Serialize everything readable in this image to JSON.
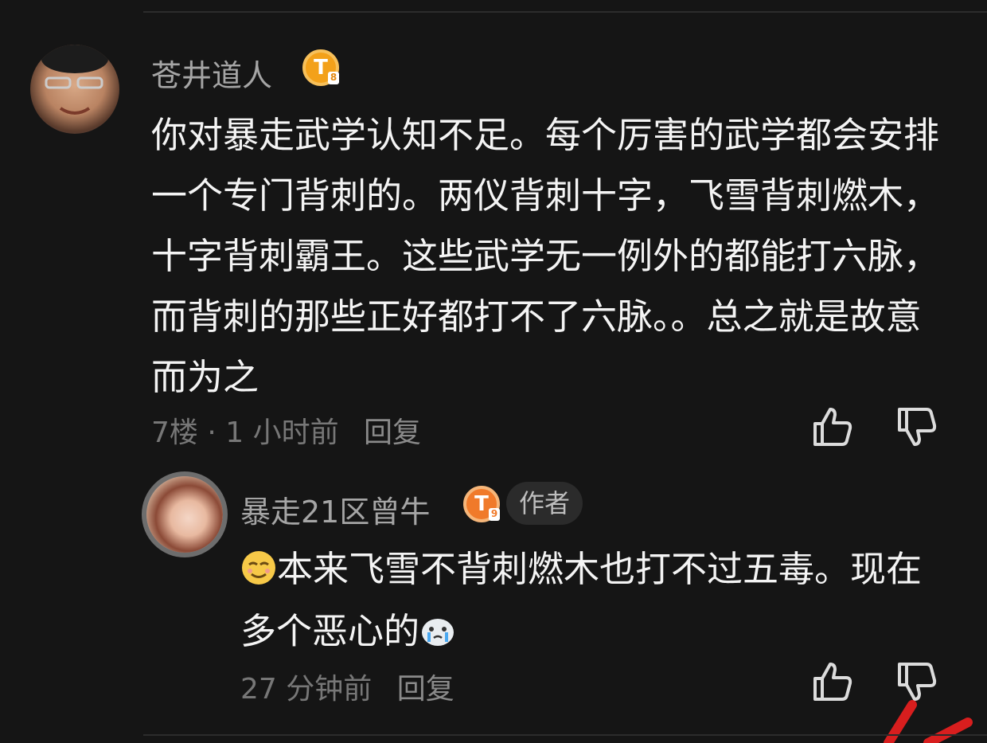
{
  "comment": {
    "username": "苍井道人",
    "badge_letter": "T",
    "badge_level": "8",
    "text": "你对暴走武学认知不足。每个厉害的武学都会安排一个专门背刺的。两仪背刺十字，飞雪背刺燃木，十字背刺霸王。这些武学无一例外的都能打六脉，而背刺的那些正好都打不了六脉。。总之就是故意而为之",
    "meta": "7楼 · 1 小时前",
    "reply_label": "回复"
  },
  "reply": {
    "username": "暴走21区曾牛",
    "badge_letter": "T",
    "badge_level": "9",
    "author_tag": "作者",
    "text": "本来飞雪不背刺燃木也打不过五毒。现在多个恶心的",
    "meta": "27 分钟前",
    "reply_label": "回复"
  },
  "icons": {
    "like": "thumbs-up-icon",
    "dislike": "thumbs-down-icon",
    "smile_emoji": "smirk-emoji",
    "cry_emoji": "crying-seal-emoji"
  },
  "colors": {
    "background": "#151515",
    "text": "#f4f4f4",
    "username": "#a5a5a5",
    "meta": "#777777",
    "badge_gold": "#f3a11a",
    "badge_orange": "#f07a2a"
  }
}
